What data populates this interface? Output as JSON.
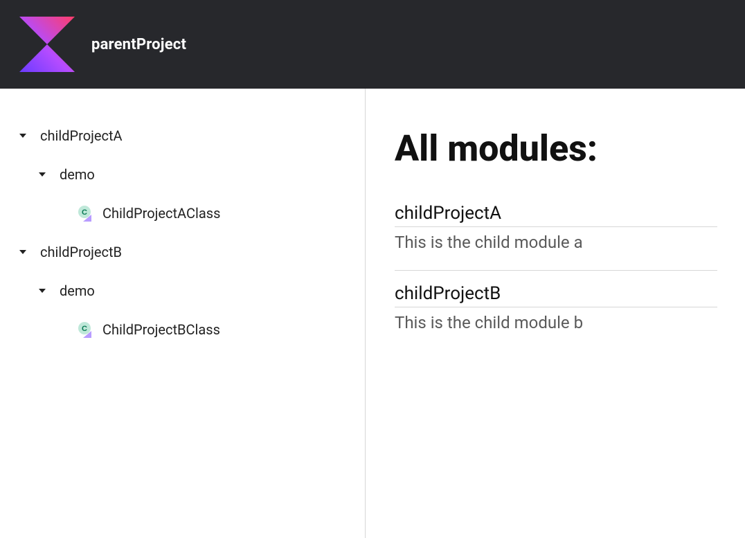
{
  "header": {
    "title": "parentProject"
  },
  "sidebar": {
    "nodes": [
      {
        "label": "childProjectA",
        "level": 1,
        "kind": "project"
      },
      {
        "label": "demo",
        "level": 2,
        "kind": "package"
      },
      {
        "label": "ChildProjectAClass",
        "level": 3,
        "kind": "class"
      },
      {
        "label": "childProjectB",
        "level": 1,
        "kind": "project"
      },
      {
        "label": "demo",
        "level": 2,
        "kind": "package"
      },
      {
        "label": "ChildProjectBClass",
        "level": 3,
        "kind": "class"
      }
    ]
  },
  "main": {
    "heading": "All modules:",
    "modules": [
      {
        "name": "childProjectA",
        "description": "This is the child module a"
      },
      {
        "name": "childProjectB",
        "description": "This is the child module b"
      }
    ]
  }
}
